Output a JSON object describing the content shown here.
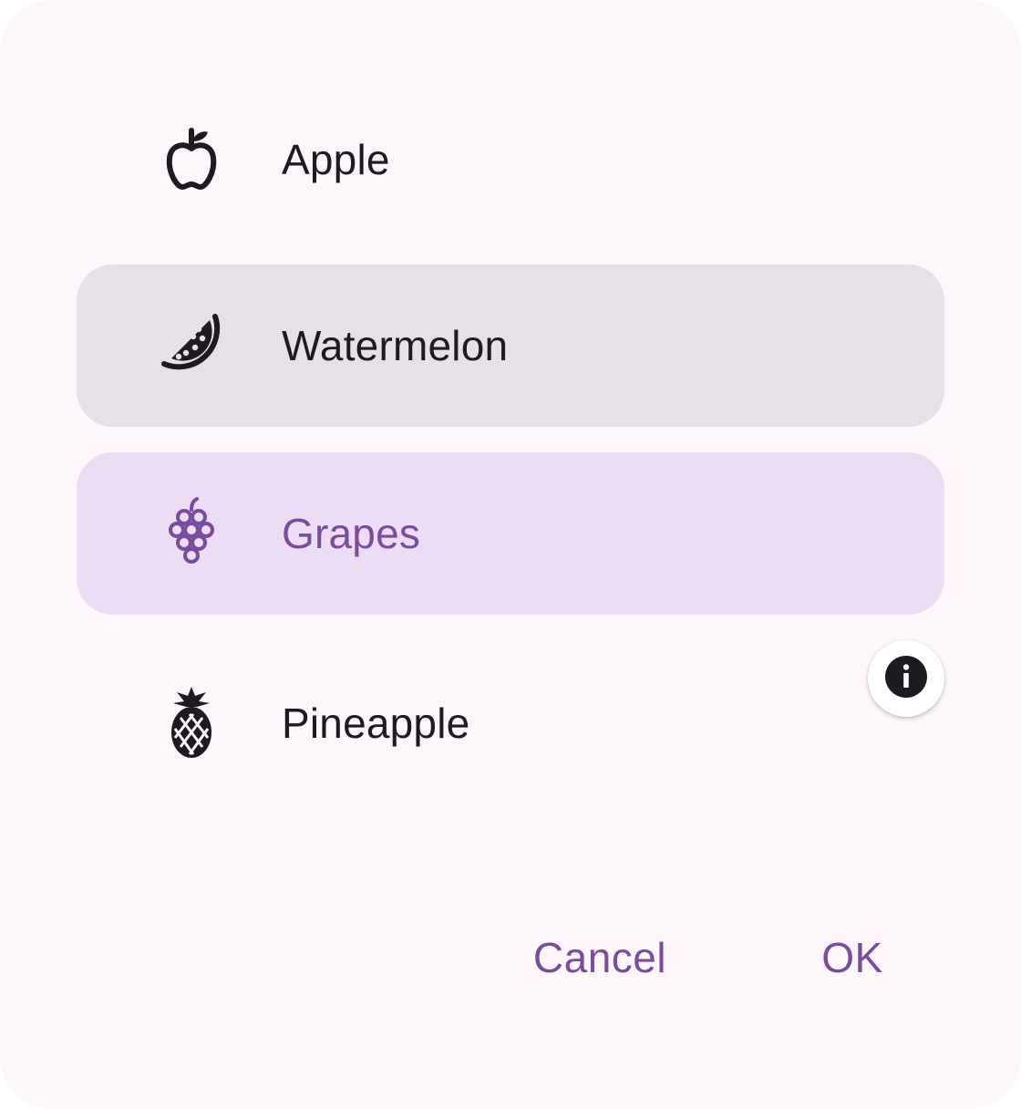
{
  "options": [
    {
      "label": "Apple",
      "icon": "apple-icon"
    },
    {
      "label": "Watermelon",
      "icon": "watermelon-icon"
    },
    {
      "label": "Grapes",
      "icon": "grapes-icon",
      "selected": true
    },
    {
      "label": "Pineapple",
      "icon": "pineapple-icon"
    }
  ],
  "info_button": {
    "icon": "info-icon"
  },
  "actions": {
    "cancel_label": "Cancel",
    "ok_label": "OK"
  },
  "colors": {
    "surface": "#fdf7fc",
    "hover": "#e8e0e8",
    "selected": "#ecdcf4",
    "accent": "#7a4ca0",
    "text": "#1d1b20"
  }
}
